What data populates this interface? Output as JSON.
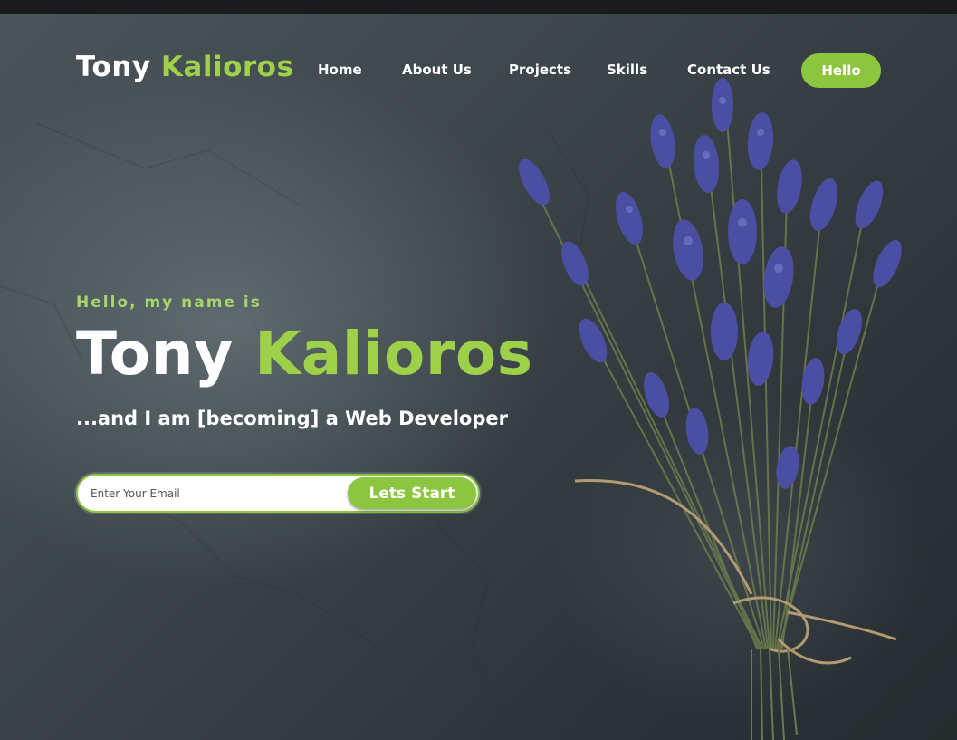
{
  "nav": {
    "logo_first": "Tony",
    "logo_last": "Kalioros",
    "items": [
      {
        "label": "Home"
      },
      {
        "label": "About Us"
      },
      {
        "label": "Projects"
      },
      {
        "label": "Skills"
      },
      {
        "label": "Contact Us"
      }
    ],
    "cta_label": "Hello"
  },
  "hero": {
    "intro": "Hello, my name is",
    "name_first": "Tony",
    "name_last": "Kalioros",
    "tagline": "...and I am [becoming] a Web Developer",
    "email_placeholder": "Enter Your Email",
    "submit_label": "Lets Start",
    "image": "lavender-bouquet"
  },
  "colors": {
    "accent": "#8cc63f",
    "accent_text": "#9ed04a",
    "background": "#3d464b"
  }
}
